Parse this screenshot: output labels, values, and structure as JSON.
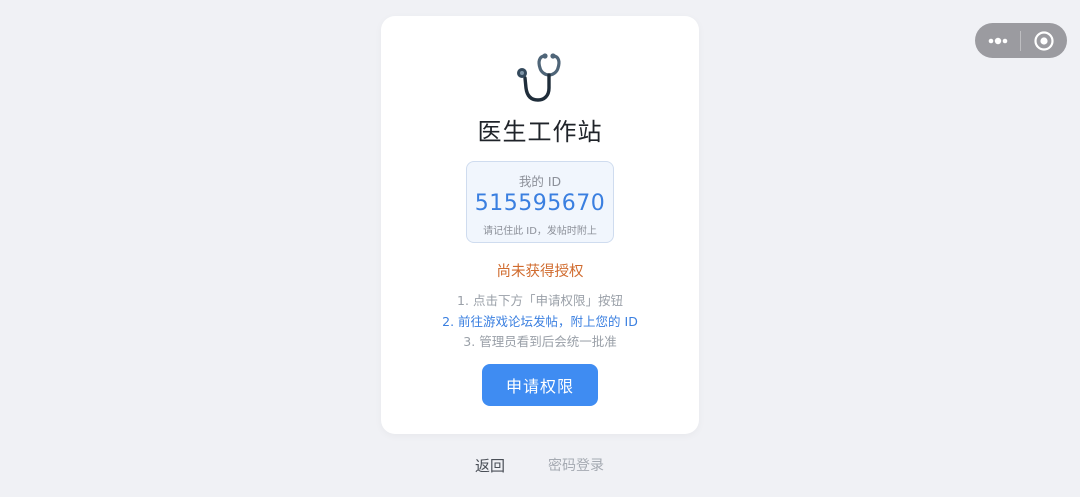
{
  "capsule": {
    "menu_icon": "more-dots-icon",
    "close_icon": "target-circle-icon"
  },
  "card": {
    "title": "医生工作站",
    "id_label": "我的 ID",
    "id_value": "515595670",
    "id_hint": "请记住此 ID，发帖时附上",
    "status": "尚未获得授权",
    "steps": [
      "1. 点击下方「申请权限」按钮",
      "2. 前往游戏论坛发帖，附上您的 ID",
      "3. 管理员看到后会统一批准"
    ],
    "apply_button": "申请权限"
  },
  "footer": {
    "back_label": "返回",
    "password_login_label": "密码登录"
  },
  "colors": {
    "background": "#f0f1f5",
    "accent": "#3f8cf2",
    "id_text": "#3a7fe0",
    "warning": "#d06b2e"
  }
}
